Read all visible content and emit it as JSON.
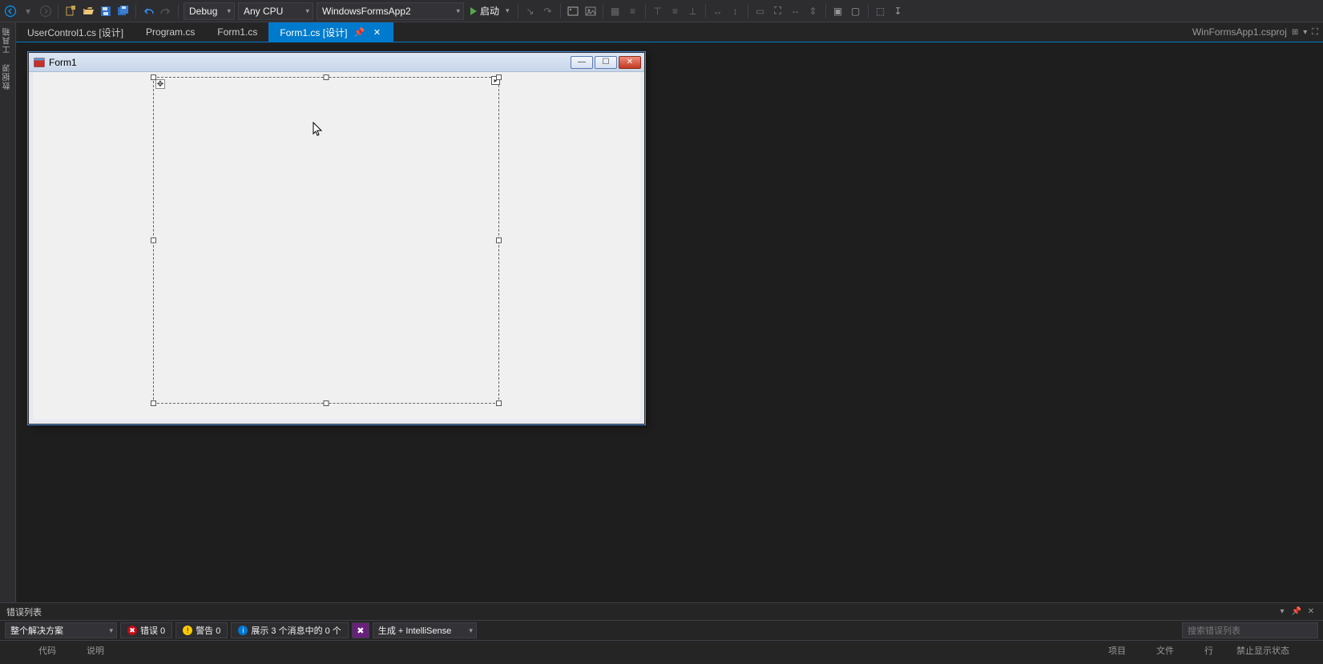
{
  "toolbar": {
    "config": "Debug",
    "platform": "Any CPU",
    "project": "WindowsFormsApp2",
    "start_label": "启动"
  },
  "document_tabs": {
    "tabs": [
      {
        "label": "UserControl1.cs [设计]"
      },
      {
        "label": "Program.cs"
      },
      {
        "label": "Form1.cs"
      },
      {
        "label": "Form1.cs [设计]",
        "active": true
      }
    ],
    "right_label": "WinFormsApp1.csproj"
  },
  "left_strip": {
    "label1": "工具箱",
    "label2": "数据源"
  },
  "designer": {
    "form_title": "Form1"
  },
  "error_list": {
    "panel_title": "错误列表",
    "scope": "整个解决方案",
    "errors_label": "错误 0",
    "warnings_label": "警告 0",
    "messages_label": "展示 3 个消息中的 0 个",
    "mode": "生成 + IntelliSense",
    "search_placeholder": "搜索错误列表",
    "col_code": "代码",
    "col_desc": "说明",
    "col_project": "项目",
    "col_file": "文件",
    "col_line": "行",
    "col_suppress": "禁止显示状态"
  }
}
